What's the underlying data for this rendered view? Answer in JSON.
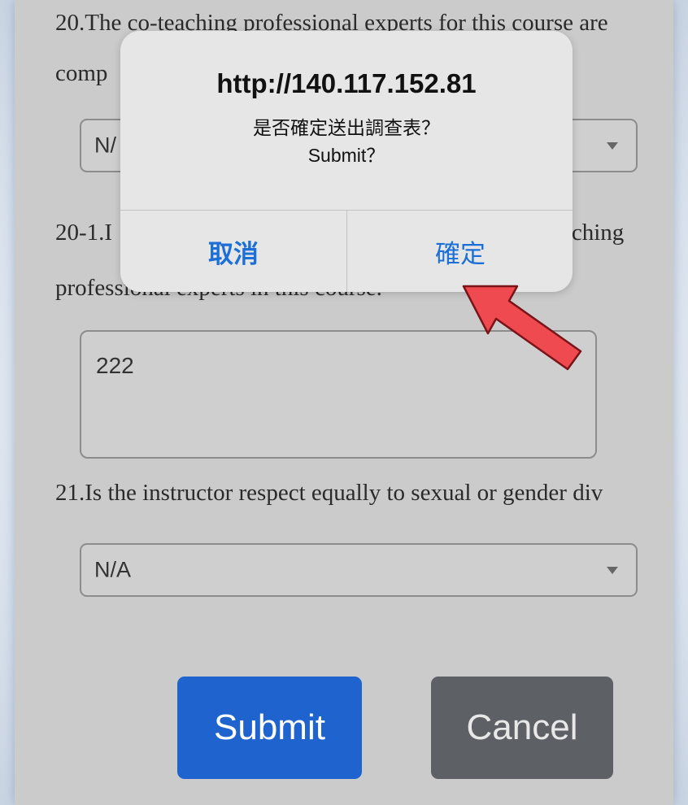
{
  "form": {
    "q20_line1": "20.The co-teaching professional experts for this course are",
    "q20_line2": "comp",
    "q20_select_value": "N/",
    "q20_1_line1_start": "20-1.I",
    "q20_1_line1_end": "aching",
    "q20_1_line2": "professional experts in this course.",
    "q20_1_answer": "222",
    "q21_line1": "21.Is the instructor respect equally to sexual or gender div",
    "q21_select_value": "N/A",
    "submit_label": "Submit",
    "cancel_label": "Cancel"
  },
  "dialog": {
    "title": "http://140.117.152.81",
    "message_zh": "是否確定送出調查表？",
    "message_en": "Submit？",
    "cancel_label": "取消",
    "confirm_label": "確定"
  },
  "colors": {
    "dialog_button_text": "#1b6fd6",
    "submit_button": "#1f63cf",
    "cancel_button": "#5d6166",
    "arrow": "#ee4a4f"
  }
}
